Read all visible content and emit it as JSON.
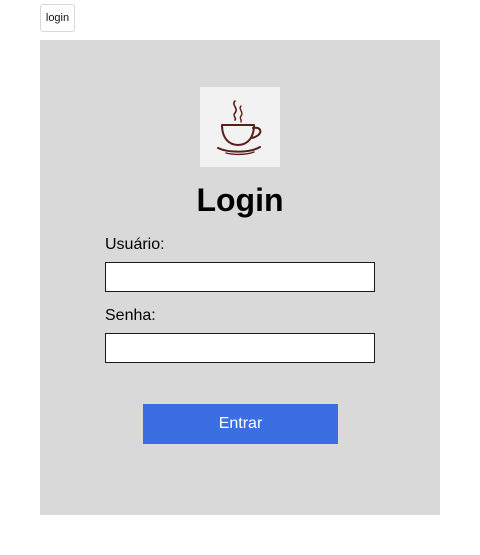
{
  "top_tab": {
    "label": "login"
  },
  "logo": {
    "icon": "coffee-cup-icon",
    "color": "#5a1f1a"
  },
  "form": {
    "title": "Login",
    "username_label": "Usuário:",
    "username_value": "",
    "password_label": "Senha:",
    "password_value": "",
    "submit_label": "Entrar"
  },
  "colors": {
    "panel_background": "#d9d9d9",
    "button_background": "#3b6de3",
    "button_text": "#ffffff"
  }
}
